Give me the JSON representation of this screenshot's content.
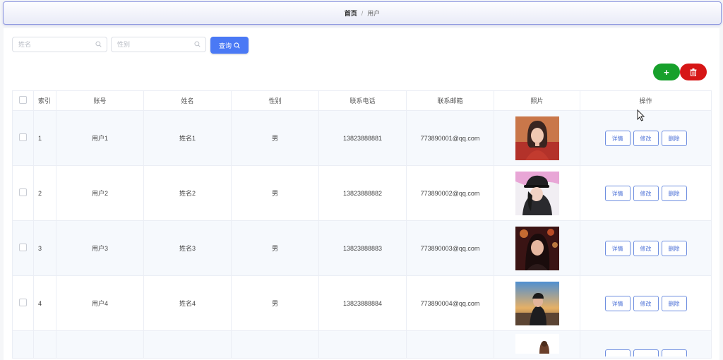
{
  "breadcrumb": {
    "home": "首页",
    "separator": "/",
    "current": "用户"
  },
  "search": {
    "name_placeholder": "姓名",
    "gender_placeholder": "性别",
    "query_label": "查询"
  },
  "actions": {
    "add_symbol": "+",
    "delete_icon": "trash-icon"
  },
  "colors": {
    "primary": "#4a79f5",
    "add": "#17a02b",
    "delete": "#d61616"
  },
  "table": {
    "headers": [
      "索引",
      "账号",
      "姓名",
      "性别",
      "联系电话",
      "联系邮箱",
      "照片",
      "操作"
    ],
    "row_buttons": {
      "detail": "详情",
      "edit": "修改",
      "delete": "删除"
    },
    "rows": [
      {
        "index": "1",
        "account": "用户1",
        "name": "姓名1",
        "gender": "男",
        "phone": "13823888881",
        "email": "773890001@qq.com"
      },
      {
        "index": "2",
        "account": "用户2",
        "name": "姓名2",
        "gender": "男",
        "phone": "13823888882",
        "email": "773890002@qq.com"
      },
      {
        "index": "3",
        "account": "用户3",
        "name": "姓名3",
        "gender": "男",
        "phone": "13823888883",
        "email": "773890003@qq.com"
      },
      {
        "index": "4",
        "account": "用户4",
        "name": "姓名4",
        "gender": "男",
        "phone": "13823888884",
        "email": "773890004@qq.com"
      }
    ]
  }
}
